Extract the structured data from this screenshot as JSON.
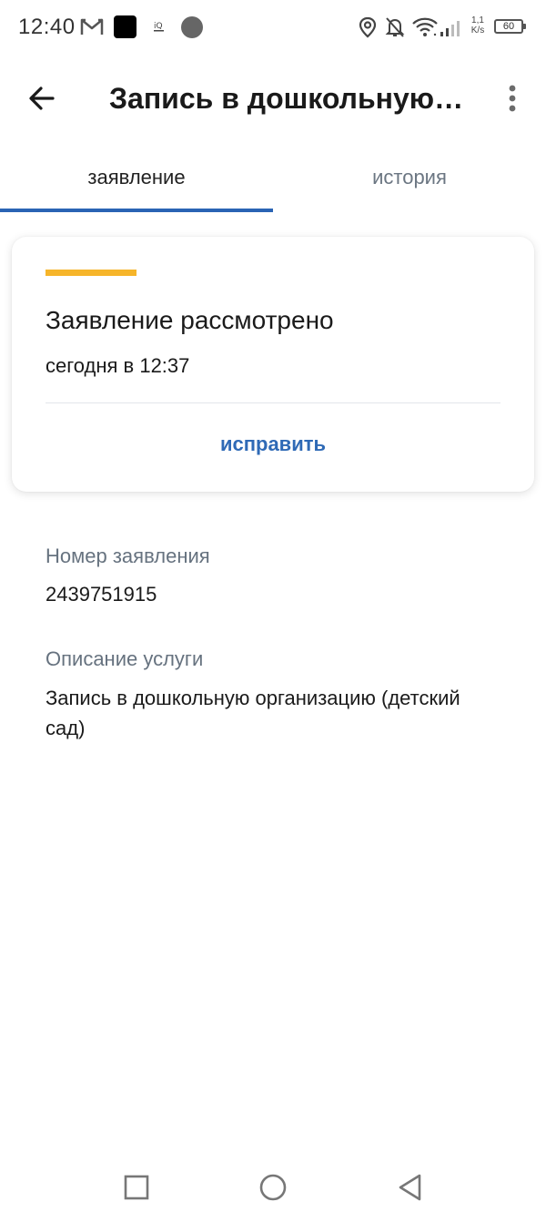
{
  "status_bar": {
    "time": "12:40",
    "network_speed_value": "1,1",
    "network_speed_unit": "K/s",
    "battery": "60",
    "icons": [
      "gmail-icon",
      "app-icon",
      "notification-icon",
      "circle-icon",
      "location-icon",
      "bell-off-icon",
      "wifi-icon",
      "signal-icon",
      "battery-icon"
    ]
  },
  "app_bar": {
    "title": "Запись в дошкольную организацию (детский сад)",
    "back_icon": "arrow-left-icon",
    "more_icon": "more-vert-icon"
  },
  "tabs": [
    {
      "label": "заявление",
      "active": true
    },
    {
      "label": "история",
      "active": false
    }
  ],
  "status_card": {
    "title": "Заявление рассмотрено",
    "time": "сегодня в 12:37",
    "action_label": "исправить",
    "accent_color": "#f6b52a"
  },
  "details": {
    "number_label": "Номер заявления",
    "number_value": "2439751915",
    "description_label": "Описание услуги",
    "description_value": "Запись в дошкольную организацию (детский сад)"
  },
  "colors": {
    "accent_blue": "#2a64b4",
    "link_blue": "#2f6ab6",
    "label_gray": "#66727f"
  },
  "nav_bar": {
    "icons": [
      "recent-apps-icon",
      "home-icon",
      "back-icon"
    ]
  }
}
